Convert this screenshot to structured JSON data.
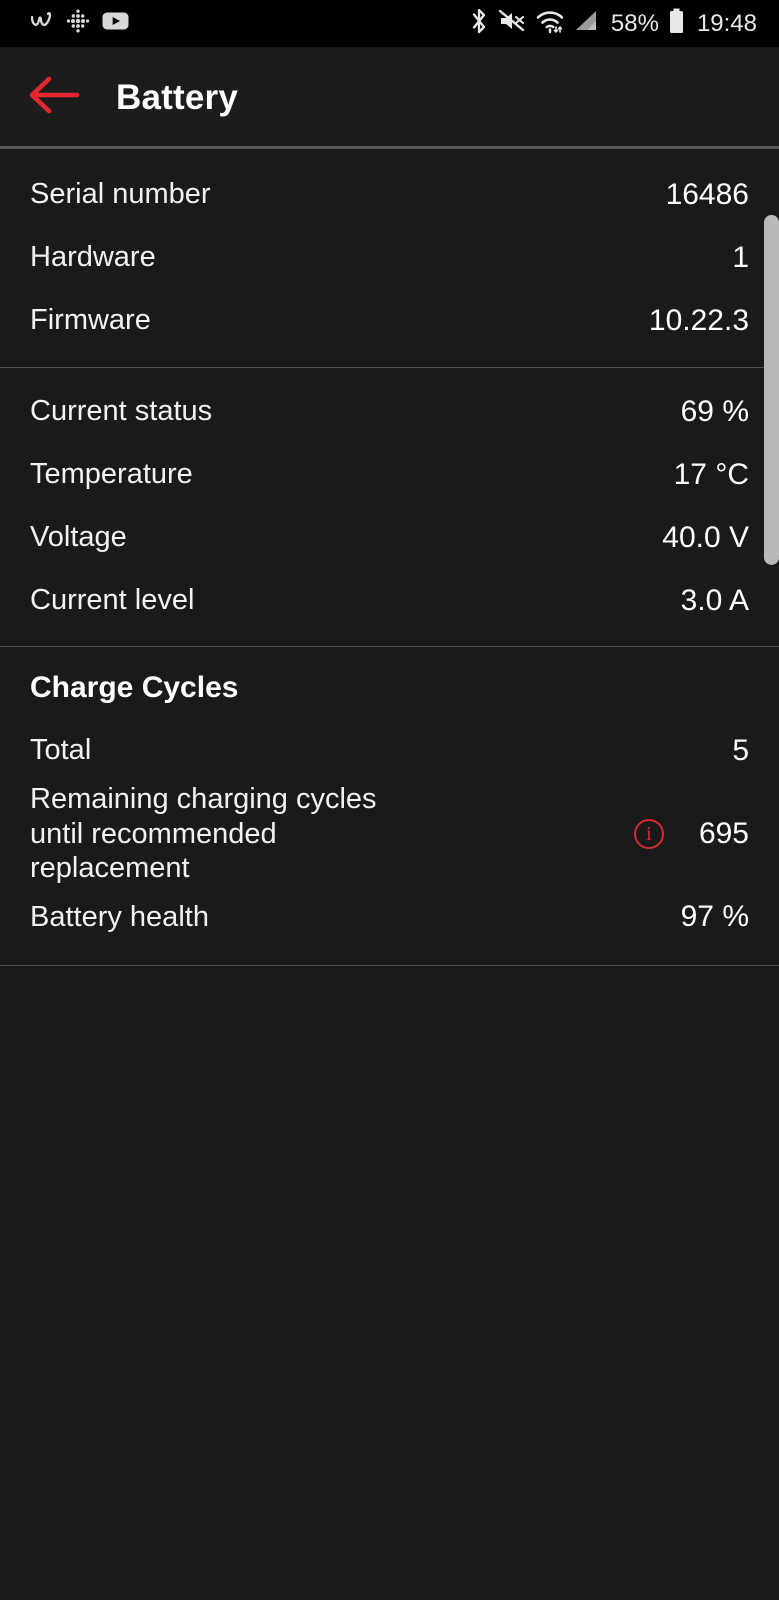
{
  "statusbar": {
    "left_icons": [
      "wondershare-w-icon",
      "fitbit-dots-icon",
      "youtube-icon"
    ],
    "right_icons": [
      "bluetooth-icon",
      "volume-mute-icon",
      "wifi-icon",
      "cellular-signal-icon",
      "battery-icon"
    ],
    "battery_percent": "58%",
    "clock": "19:48"
  },
  "appbar": {
    "back_icon": "arrow-left-icon",
    "title": "Battery",
    "accent_color": "#e8262f"
  },
  "sections": [
    {
      "id": "device",
      "title": null,
      "rows": [
        {
          "label": "Serial number",
          "value": "16486"
        },
        {
          "label": "Hardware",
          "value": "1"
        },
        {
          "label": "Firmware",
          "value": "10.22.3"
        }
      ]
    },
    {
      "id": "status",
      "title": null,
      "rows": [
        {
          "label": "Current status",
          "value": "69 %"
        },
        {
          "label": "Temperature",
          "value": "17 °C"
        },
        {
          "label": "Voltage",
          "value": "40.0 V"
        },
        {
          "label": "Current level",
          "value": "3.0 A"
        }
      ]
    },
    {
      "id": "cycles",
      "title": "Charge Cycles",
      "rows": [
        {
          "label": "Total",
          "value": "5"
        },
        {
          "label": "Remaining charging cycles\nuntil recommended\nreplacement",
          "value": "695",
          "info_icon": "info-circle-icon"
        },
        {
          "label": "Battery health",
          "value": "97 %"
        }
      ]
    }
  ],
  "scrollbar": {
    "name": "vertical-scrollbar"
  },
  "colors": {
    "background": "#1a1a1a",
    "statusbar_background": "#000000",
    "appbar_background": "#1c1c1c",
    "divider": "#4c4e50",
    "text_primary": "#ffffff",
    "accent_red": "#d32b33",
    "scrollbar": "#b9b9b9"
  }
}
